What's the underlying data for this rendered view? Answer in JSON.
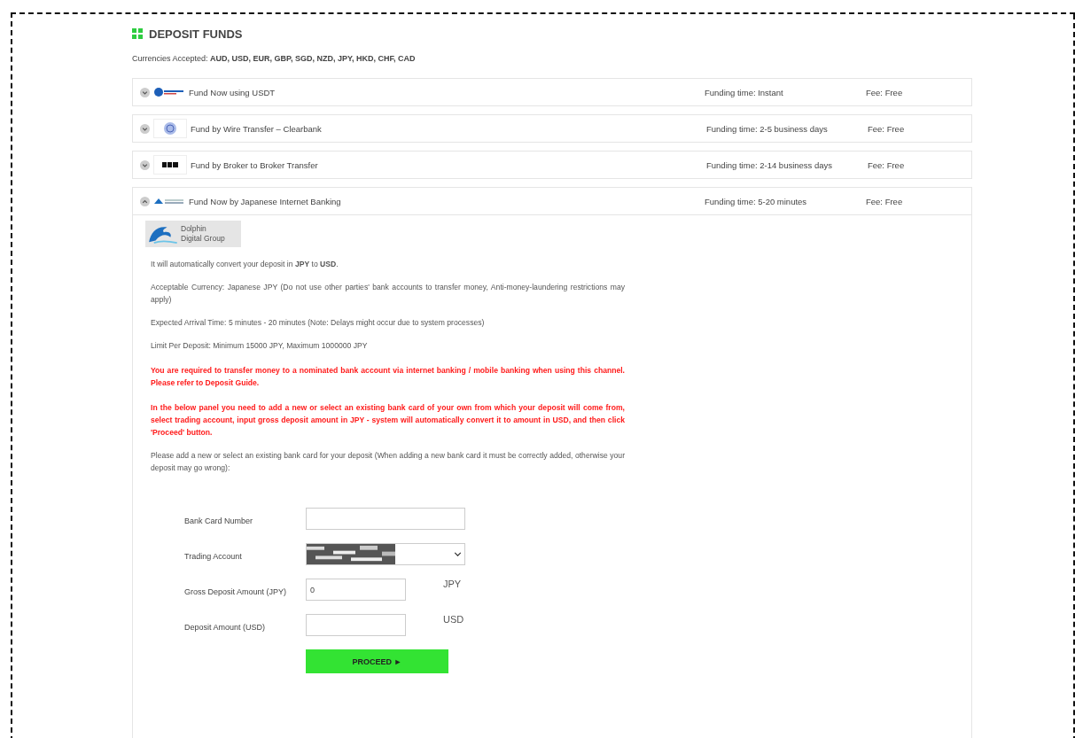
{
  "title": "DEPOSIT FUNDS",
  "currencies": "Currencies Accepted: **AUD, USD, EUR, GBP, SGD, NZD, JPY, HKD, CHF, CAD**",
  "methods": [
    {
      "name": "Fund Now using USDT",
      "kind": "usdt",
      "funding_time": "Funding time: Instant",
      "fee": "Fee: Free",
      "expanded": false
    },
    {
      "name": "Fund by Wire Transfer – Clearbank",
      "kind": "globe",
      "funding_time": "Funding time: 2-5 business days",
      "fee": "Fee: Free",
      "expanded": false
    },
    {
      "name": "Fund by Broker to Broker Transfer",
      "kind": "broker",
      "funding_time": "Funding time: 2-14 business days",
      "fee": "Fee: Free",
      "expanded": false
    },
    {
      "name": "Fund Now by Japanese Internet Banking",
      "kind": "bank",
      "funding_time": "Funding time: 5-20 minutes",
      "fee": "Fee: Free",
      "expanded": true
    }
  ],
  "panel": {
    "brand": [
      "Dolphin",
      "Digital Group"
    ],
    "paragraphs": [
      {
        "kind": "note",
        "text": "It will automatically convert your deposit in **JPY** to **USD**."
      },
      {
        "kind": "note",
        "text": "Acceptable Currency: Japanese JPY (Do not use other parties' bank accounts to transfer money, Anti-money-laundering restrictions may apply)"
      },
      {
        "kind": "note",
        "text": "Expected Arrival Time: 5 minutes - 20 minutes (Note: Delays might occur due to system processes)"
      },
      {
        "kind": "note",
        "text": "Limit Per Deposit: Minimum 15000 JPY, Maximum 1000000 JPY"
      },
      {
        "kind": "warning",
        "text": "You are required to transfer money to a nominated bank account via internet banking / mobile banking when using this channel. Please refer to Deposit Guide."
      },
      {
        "kind": "warning",
        "text": "In the below panel you need to add a new or select an existing bank card of your own from which your deposit will come from, select trading account, input gross deposit amount in JPY - system will automatically convert it to amount in USD, and then click 'Proceed' button."
      },
      {
        "kind": "note",
        "text": "Please add a new or select an existing bank card for your deposit (When adding a new bank card it must be correctly added, otherwise your deposit may go wrong):"
      }
    ],
    "form": [
      {
        "kind": "text",
        "label": "Bank Card Number"
      },
      {
        "kind": "select",
        "label": "Trading Account"
      },
      {
        "kind": "text",
        "label": "Gross Deposit Amount (JPY)",
        "value": "0",
        "unit": "JPY"
      },
      {
        "kind": "text",
        "label": "Deposit Amount (USD)",
        "unit": "USD"
      }
    ],
    "button": "PROCEED ►"
  }
}
